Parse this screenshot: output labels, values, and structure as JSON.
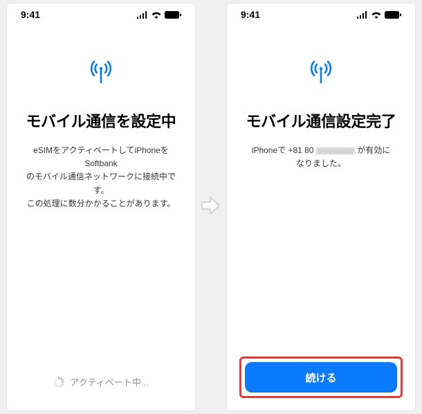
{
  "status": {
    "time": "9:41"
  },
  "screen1": {
    "title": "モバイル通信を設定中",
    "desc_line1": "eSIMをアクティベートしてiPhoneをSoftbank",
    "desc_line2": "のモバイル通信ネットワークに接続中です。",
    "desc_line3": "この処理に数分かかることがあります。",
    "activating": "アクティベート中..."
  },
  "screen2": {
    "title": "モバイル通信設定完了",
    "desc_prefix": "iPhoneで +81 80 ",
    "desc_suffix": " が有効に",
    "desc_line2": "なりました。",
    "continue": "続ける"
  }
}
